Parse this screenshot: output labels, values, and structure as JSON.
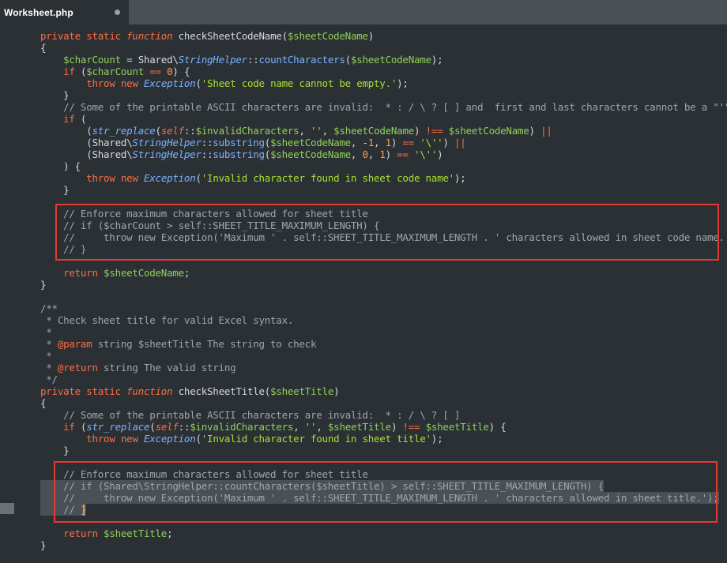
{
  "tab": {
    "title": "Worksheet.php"
  },
  "lines": [
    "private static function checkSheetCodeName($sheetCodeName)",
    "{",
    "    $charCount = Shared\\StringHelper::countCharacters($sheetCodeName);",
    "    if ($charCount == 0) {",
    "        throw new Exception('Sheet code name cannot be empty.');",
    "    }",
    "    // Some of the printable ASCII characters are invalid:  * : / \\ ? [ ] and  first and last characters cannot be a \"'\"",
    "    if (",
    "        (str_replace(self::$invalidCharacters, '', $sheetCodeName) !== $sheetCodeName) ||",
    "        (Shared\\StringHelper::substring($sheetCodeName, -1, 1) == '\\'') ||",
    "        (Shared\\StringHelper::substring($sheetCodeName, 0, 1) == '\\'')",
    "    ) {",
    "        throw new Exception('Invalid character found in sheet code name');",
    "    }",
    "",
    "    // Enforce maximum characters allowed for sheet title",
    "    // if ($charCount > self::SHEET_TITLE_MAXIMUM_LENGTH) {",
    "    //     throw new Exception('Maximum ' . self::SHEET_TITLE_MAXIMUM_LENGTH . ' characters allowed in sheet code name.');",
    "    // }",
    "",
    "    return $sheetCodeName;",
    "}",
    "",
    "/**",
    " * Check sheet title for valid Excel syntax.",
    " *",
    " * @param string $sheetTitle The string to check",
    " *",
    " * @return string The valid string",
    " */",
    "private static function checkSheetTitle($sheetTitle)",
    "{",
    "    // Some of the printable ASCII characters are invalid:  * : / \\ ? [ ]",
    "    if (str_replace(self::$invalidCharacters, '', $sheetTitle) !== $sheetTitle) {",
    "        throw new Exception('Invalid character found in sheet title');",
    "    }",
    "",
    "    // Enforce maximum characters allowed for sheet title",
    "    // if (Shared\\StringHelper::countCharacters($sheetTitle) > self::SHEET_TITLE_MAXIMUM_LENGTH) {",
    "    //     throw new Exception('Maximum ' . self::SHEET_TITLE_MAXIMUM_LENGTH . ' characters allowed in sheet title.');",
    "    // }",
    "",
    "    return $sheetTitle;",
    "}"
  ],
  "colors": {
    "annotation_box": "#e53935",
    "cursor": "#f0a030",
    "selection": "#4a5056"
  }
}
